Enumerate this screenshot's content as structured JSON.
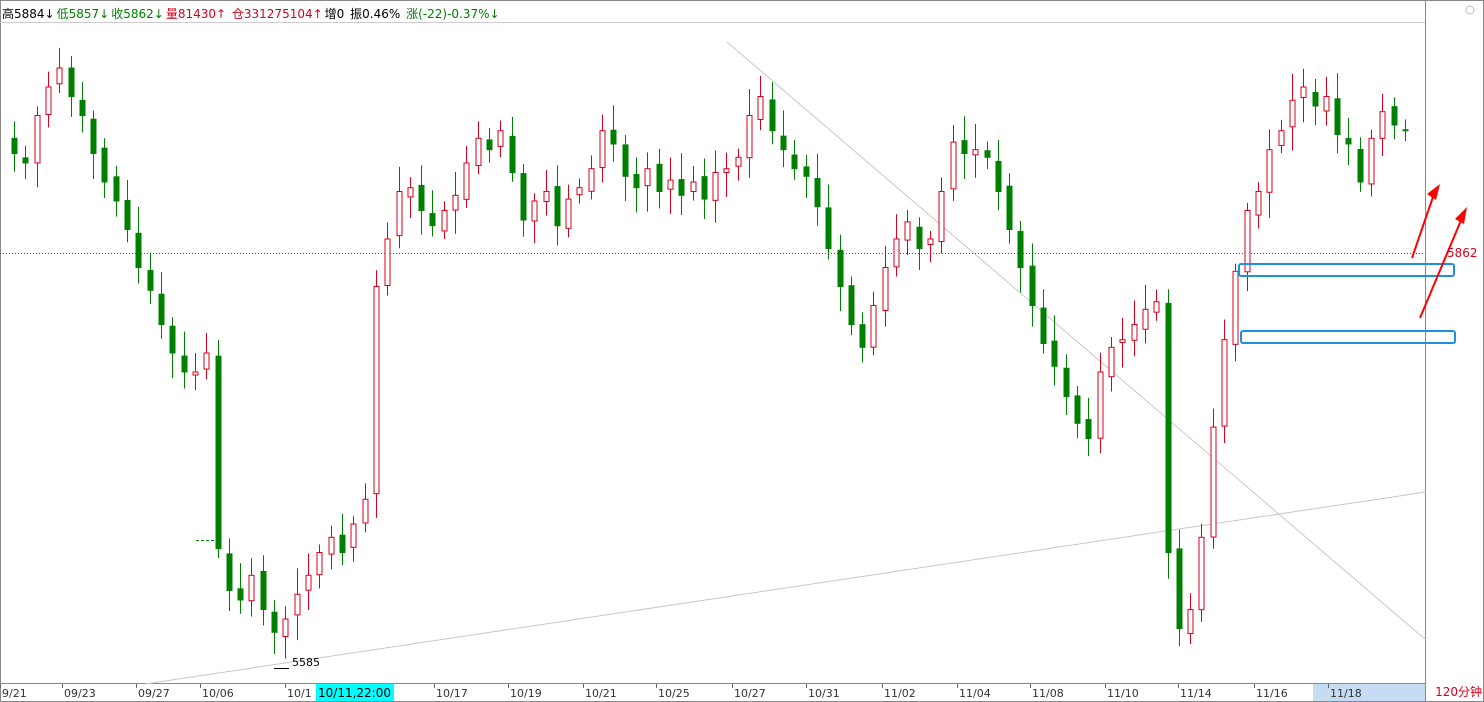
{
  "info_bar": {
    "high": "高5884↓",
    "low": "低5857↓",
    "close": "收5862↓",
    "volume": "量81430↑",
    "open_interest": "仓331275104↑",
    "oi_change": "增0",
    "amplitude": "振0.46%",
    "change": "涨(-22)-0.37%↓"
  },
  "chart": {
    "period": "120分钟",
    "last_price": "5862",
    "low_annotation": "5585",
    "cursor_time": "10/11,22:00",
    "x_ticks": [
      "9/21",
      "09/23",
      "09/27",
      "10/06",
      "10/1",
      "10/17",
      "10/19",
      "10/21",
      "10/25",
      "10/27",
      "10/31",
      "11/02",
      "11/04",
      "11/08",
      "11/10",
      "11/14",
      "11/16",
      "11/18"
    ],
    "colors": {
      "up": "#d9001b",
      "down": "#008000",
      "box": "#1e90e0",
      "arrow": "#ff0000",
      "cursor": "#00ffff"
    }
  },
  "chart_data": {
    "type": "candlestick",
    "title": "",
    "timeframe": "120分钟",
    "y_range": [
      5575,
      5915
    ],
    "last_close": 5862,
    "period_low": 5585,
    "candles_approx_close": [
      5850,
      5845,
      5870,
      5885,
      5895,
      5880,
      5870,
      5850,
      5835,
      5825,
      5810,
      5790,
      5778,
      5760,
      5745,
      5735,
      5735,
      5745,
      5642,
      5620,
      5615,
      5628,
      5610,
      5598,
      5605,
      5618,
      5628,
      5640,
      5648,
      5640,
      5655,
      5668,
      5780,
      5805,
      5830,
      5832,
      5820,
      5812,
      5820,
      5828,
      5845,
      5858,
      5852,
      5862,
      5840,
      5815,
      5825,
      5830,
      5812,
      5826,
      5832,
      5842,
      5862,
      5855,
      5838,
      5832,
      5842,
      5830,
      5836,
      5828,
      5835,
      5826,
      5840,
      5842,
      5848,
      5870,
      5880,
      5862,
      5852,
      5842,
      5838,
      5822,
      5800,
      5780,
      5760,
      5748,
      5770,
      5790,
      5805,
      5814,
      5800,
      5805,
      5830,
      5856,
      5850,
      5852,
      5848,
      5830,
      5810,
      5790,
      5770,
      5750,
      5738,
      5722,
      5708,
      5700,
      5735,
      5748,
      5752,
      5760,
      5768,
      5772,
      5640,
      5600,
      5610,
      5648,
      5706,
      5752,
      5788,
      5820,
      5830,
      5852,
      5862,
      5878,
      5885,
      5875,
      5880,
      5860,
      5855,
      5835,
      5858,
      5872,
      5865,
      5862
    ]
  }
}
